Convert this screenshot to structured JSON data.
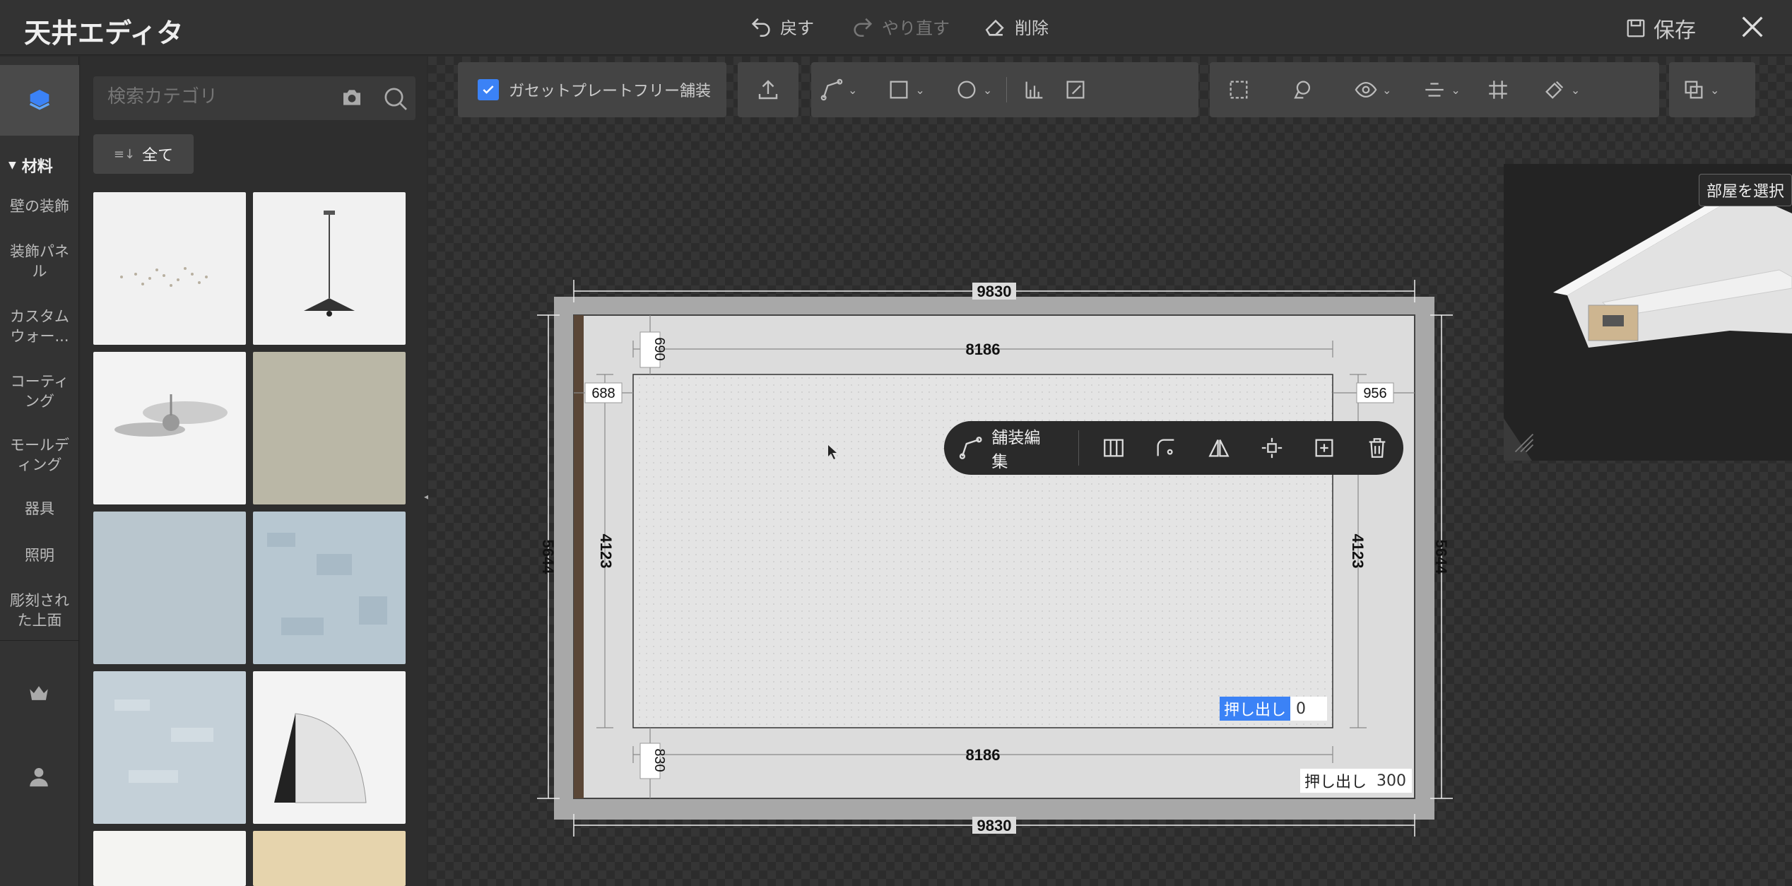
{
  "app": {
    "title": "天井エディタ"
  },
  "header": {
    "undo_label": "戻す",
    "redo_label": "やり直す",
    "delete_label": "削除",
    "save_label": "保存"
  },
  "sidebar": {
    "heading": "材料",
    "items": [
      {
        "label": "壁の装飾"
      },
      {
        "label": "装飾パネル"
      },
      {
        "label": "カスタムウォー..."
      },
      {
        "label": "コーティング"
      },
      {
        "label": "モールディング"
      },
      {
        "label": "器具"
      },
      {
        "label": "照明"
      },
      {
        "label": "彫刻された上面"
      }
    ]
  },
  "catalog": {
    "search_placeholder": "検索カテゴリ",
    "filter_label": "全て"
  },
  "toolbar": {
    "gasket_label": "ガセットプレートフリー舗装",
    "gasket_checked": true
  },
  "floating_toolbar": {
    "edit_label": "舗装編集"
  },
  "dimensions": {
    "outer_width_top": "9830",
    "outer_width_bottom": "9830",
    "inner_width_top": "8186",
    "inner_width_bottom": "8186",
    "outer_height_left": "5644",
    "outer_height_right": "5644",
    "inner_height_left": "4123",
    "inner_height_right": "4123",
    "offset_top": "690",
    "offset_bottom": "830",
    "offset_left": "688",
    "offset_right": "956"
  },
  "extrude_inner": {
    "label": "押し出し",
    "value": "0"
  },
  "extrude_outer": {
    "label": "押し出し",
    "value": "300"
  },
  "preview": {
    "room_select_label": "部屋を選択"
  },
  "colors": {
    "accent": "#3b82f6",
    "panel": "#333333",
    "canvas": "#353535"
  }
}
